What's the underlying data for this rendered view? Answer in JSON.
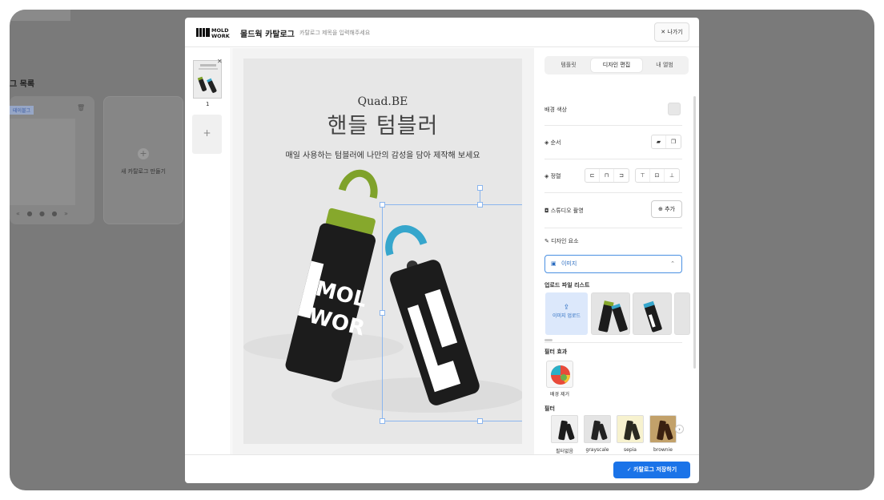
{
  "background": {
    "list_title": "그 목록",
    "card_tag": "테이블그",
    "new_catalog_label": "새 카탈로그 만들기",
    "pager": "« ● ● ● »"
  },
  "modal": {
    "logo_text_top": "MOLD",
    "logo_text_bottom": "WORK",
    "title": "몰드웍 카탈로그",
    "title_hint": "카탈로그 제목을 입력해주세요",
    "close_label": "나가기",
    "pages": [
      {
        "number": "1"
      }
    ],
    "add_page": "+",
    "canvas": {
      "brand": "Quad.BE",
      "headline": "핸들 텀블러",
      "subline": "매일 사용하는 텀블러에 나만의 감성을 담아 제작해 보세요"
    },
    "tabs": [
      "템플릿",
      "디자인 편집",
      "내 앨범"
    ],
    "active_tab": "디자인 편집",
    "panel": {
      "bg_color_label": "배경 색상",
      "bg_color_value": "#e7e7e7",
      "order_label": "순서",
      "align_label": "정렬",
      "studio_label": "스튜디오 촬영",
      "studio_add": "추가",
      "design_elements_label": "디자인 요소",
      "element_type": "이미지",
      "upload_list_label": "업로드 파일 리스트",
      "upload_button": "이미지 업로드",
      "effect_label": "필터 효과",
      "effect_name": "배경 제거",
      "filter_label": "필터",
      "filters": [
        "필터없음",
        "grayscale",
        "sepia",
        "brownie"
      ]
    },
    "save_label": "카탈로그 저장하기"
  }
}
